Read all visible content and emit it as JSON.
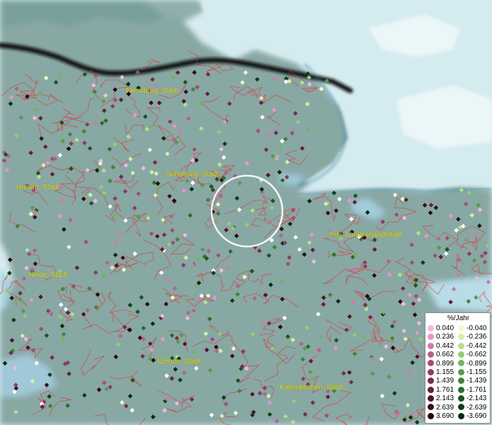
{
  "legend": {
    "title": "%/Jahr",
    "positive": [
      {
        "label": "0.040",
        "color": "#f5b8e2"
      },
      {
        "label": "0.236",
        "color": "#e896c8"
      },
      {
        "label": "0.442",
        "color": "#d07aa8"
      },
      {
        "label": "0.662",
        "color": "#b8608c"
      },
      {
        "label": "0.899",
        "color": "#a04c74"
      },
      {
        "label": "1.155",
        "color": "#8c3c60"
      },
      {
        "label": "1.439",
        "color": "#782c4c"
      },
      {
        "label": "1.761",
        "color": "#641e38"
      },
      {
        "label": "2.143",
        "color": "#501428"
      },
      {
        "label": "2.639",
        "color": "#3c0c1c"
      },
      {
        "label": "3.690",
        "color": "#280410"
      }
    ],
    "negative": [
      {
        "label": "-0.040",
        "color": "#f0fac8"
      },
      {
        "label": "-0.236",
        "color": "#d4f0a8"
      },
      {
        "label": "-0.442",
        "color": "#b4e08c"
      },
      {
        "label": "-0.662",
        "color": "#94cc74"
      },
      {
        "label": "-0.899",
        "color": "#74b45c"
      },
      {
        "label": "-1.155",
        "color": "#589c48"
      },
      {
        "label": "-1.439",
        "color": "#408438"
      },
      {
        "label": "-1.761",
        "color": "#2c6c28"
      },
      {
        "label": "-2.143",
        "color": "#1c541c"
      },
      {
        "label": "-2.639",
        "color": "#0c4010"
      },
      {
        "label": "-3.690",
        "color": "#042c08"
      }
    ]
  },
  "cities": [
    {
      "name": "Flensburg, Stadt"
    },
    {
      "name": "Schleswig, Stadt"
    },
    {
      "name": "Husum, Stadt"
    },
    {
      "name": "Kiel, Landeshauptstadt"
    },
    {
      "name": "Heide, Stadt"
    },
    {
      "name": "Itzehoe, Stadt"
    },
    {
      "name": "Kaltenkirchen, Stadt"
    }
  ],
  "colors": {
    "land": "#88a8a4",
    "water": "#d8ebf0",
    "border": "#e03030",
    "coast": "#3a88a8",
    "highlight_circle": "#ffffff"
  }
}
